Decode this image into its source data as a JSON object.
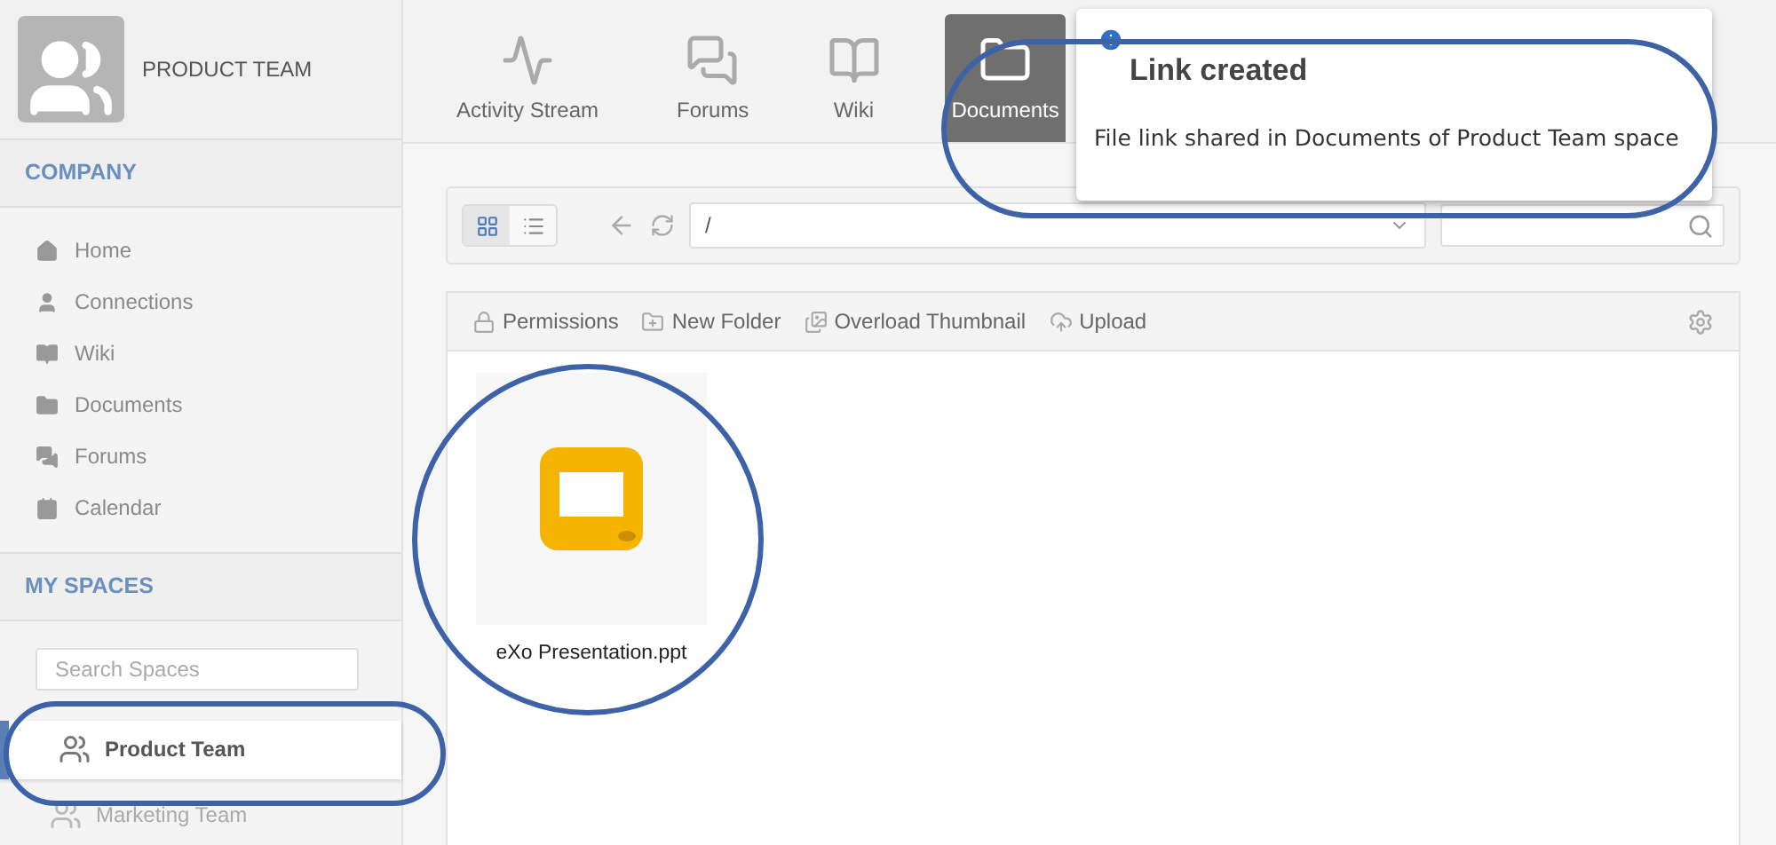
{
  "space": {
    "name": "PRODUCT TEAM"
  },
  "nav_tabs": [
    {
      "label": "Activity Stream",
      "kind": "activity",
      "selected": false
    },
    {
      "label": "Forums",
      "kind": "forums",
      "selected": false
    },
    {
      "label": "Wiki",
      "kind": "wiki",
      "selected": false
    },
    {
      "label": "Documents",
      "kind": "documents",
      "selected": true
    }
  ],
  "company": {
    "title": "COMPANY",
    "items": [
      {
        "label": "Home",
        "kind": "home"
      },
      {
        "label": "Connections",
        "kind": "connections"
      },
      {
        "label": "Wiki",
        "kind": "wiki"
      },
      {
        "label": "Documents",
        "kind": "documents"
      },
      {
        "label": "Forums",
        "kind": "forums"
      },
      {
        "label": "Calendar",
        "kind": "calendar"
      }
    ]
  },
  "my_spaces": {
    "title": "MY SPACES",
    "search": {
      "placeholder": "Search Spaces"
    },
    "spaces": [
      {
        "label": "Product Team",
        "selected": true
      },
      {
        "label": "Marketing Team",
        "selected": false
      }
    ]
  },
  "toolbar": {
    "views": [
      {
        "kind": "grid",
        "selected": true
      },
      {
        "kind": "list",
        "selected": false
      }
    ],
    "path": "/"
  },
  "actions": [
    {
      "label": "Permissions",
      "kind": "lock"
    },
    {
      "label": "New Folder",
      "kind": "folder"
    },
    {
      "label": "Overload Thumbnail",
      "kind": "thumbnail"
    },
    {
      "label": "Upload",
      "kind": "upload"
    }
  ],
  "files": [
    {
      "name": "eXo Presentation.ppt",
      "kind": "presentation"
    }
  ],
  "notification": {
    "title": "Link created",
    "message": "File link shared in Documents of Product Team space"
  }
}
